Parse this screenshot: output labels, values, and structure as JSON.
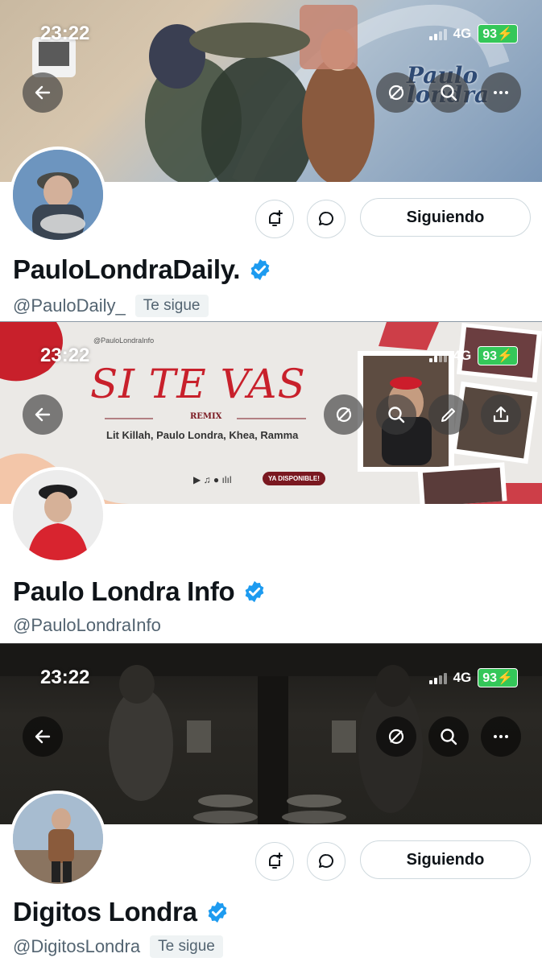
{
  "status": {
    "time": "23:22",
    "network": "4G",
    "battery": "93"
  },
  "profiles": [
    {
      "banner_text": "Paulo londra",
      "name": "PauloLondraDaily.",
      "handle": "@PauloDaily_",
      "follows_you": "Te sigue",
      "follow_label": "Siguiendo"
    },
    {
      "banner_title": "SI TE VAS",
      "banner_subtitle": "REMIX",
      "banner_artists": "Lit Killah, Paulo Londra, Khea, Ramma",
      "banner_badge": "YA DISPONIBLE!",
      "banner_credit": "@PauloLondraInfo",
      "name": "Paulo Londra Info",
      "handle": "@PauloLondraInfo"
    },
    {
      "name": "Digitos Londra",
      "handle": "@DigitosLondra",
      "follows_you": "Te sigue",
      "follow_label": "Siguiendo"
    }
  ],
  "colors": {
    "verified": "#1d9bf0",
    "battery": "#34c759",
    "text": "#0f1419",
    "muted": "#536471",
    "banner_red": "#c8202b"
  },
  "icons": [
    "back-arrow-icon",
    "hide-icon",
    "search-icon",
    "more-icon",
    "edit-icon",
    "share-icon",
    "bell-plus-icon",
    "message-icon",
    "verified-icon"
  ]
}
